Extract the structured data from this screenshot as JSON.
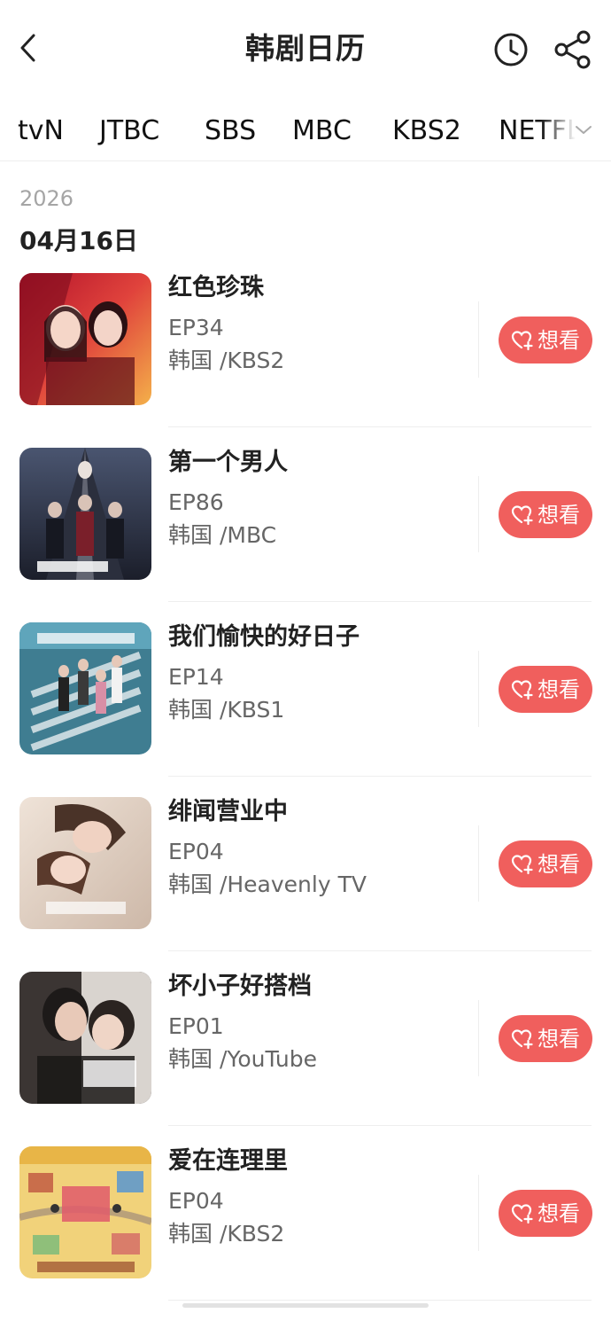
{
  "header": {
    "title": "韩剧日历",
    "back_icon": "chevron-left-icon",
    "history_icon": "clock-icon",
    "share_icon": "share-icon"
  },
  "tabs": {
    "items": [
      "tvN",
      "JTBC",
      "SBS",
      "MBC",
      "KBS2",
      "NETFLIX"
    ],
    "more_icon": "chevron-down-icon"
  },
  "calendar": {
    "year": "2026",
    "date": "04月16日"
  },
  "shows": [
    {
      "title": "红色珍珠",
      "episode": "EP34",
      "origin": "韩国 /KBS2",
      "button": "想看",
      "poster_icon": "poster-red-pearl-image"
    },
    {
      "title": "第一个男人",
      "episode": "EP86",
      "origin": "韩国 /MBC",
      "button": "想看",
      "poster_icon": "poster-first-man-image"
    },
    {
      "title": "我们愉快的好日子",
      "episode": "EP14",
      "origin": "韩国 /KBS1",
      "button": "想看",
      "poster_icon": "poster-happy-days-image"
    },
    {
      "title": "绯闻营业中",
      "episode": "EP04",
      "origin": "韩国 /Heavenly TV",
      "button": "想看",
      "poster_icon": "poster-scandal-image"
    },
    {
      "title": "坏小子好搭档",
      "episode": "EP01",
      "origin": "韩国 /YouTube",
      "button": "想看",
      "poster_icon": "poster-bad-kid-image"
    },
    {
      "title": "爱在连理里",
      "episode": "EP04",
      "origin": "韩国 /KBS2",
      "button": "想看",
      "poster_icon": "poster-love-village-image"
    }
  ],
  "colors": {
    "accent": "#f05f5d",
    "muted_text": "#666666",
    "year_text": "#a5a5a5"
  }
}
